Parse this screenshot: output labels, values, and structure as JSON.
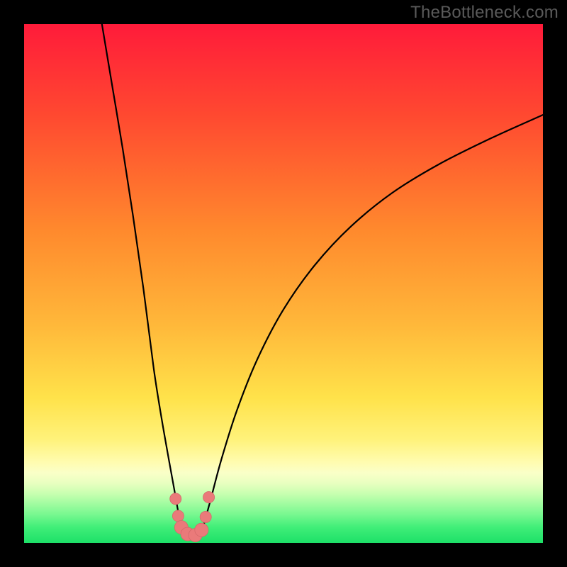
{
  "watermark": "TheBottleneck.com",
  "colors": {
    "bg_black": "#000000",
    "grad_top": "#ff1b3a",
    "grad_mid_upper": "#ff6a2a",
    "grad_mid": "#ffb03a",
    "grad_mid_lower": "#ffe24a",
    "grad_lightband1": "#fff6a8",
    "grad_lightband2": "#f8ffb0",
    "grad_green_light": "#8efc8f",
    "grad_green": "#29e36a",
    "curve_color": "#000000",
    "marker_fill": "#ea7a7a",
    "marker_stroke": "#d46a6a"
  },
  "chart_data": {
    "type": "line",
    "title": "",
    "xlabel": "",
    "ylabel": "",
    "xlim": [
      0,
      100
    ],
    "ylim": [
      0,
      100
    ],
    "note": "Values estimated from pixel positions; axes unlabeled so normalized 0-100 scale is used.",
    "series": [
      {
        "name": "left-branch",
        "x": [
          15.0,
          17.0,
          19.0,
          21.0,
          23.0,
          25.0,
          26.5,
          28.0,
          29.0,
          29.8,
          30.5
        ],
        "y": [
          100.0,
          88.0,
          76.0,
          63.0,
          49.0,
          33.5,
          24.0,
          15.5,
          10.0,
          5.5,
          2.5
        ]
      },
      {
        "name": "valley-floor",
        "x": [
          30.5,
          31.5,
          32.5,
          33.5,
          34.5
        ],
        "y": [
          2.5,
          1.5,
          1.3,
          1.6,
          3.0
        ]
      },
      {
        "name": "right-branch",
        "x": [
          34.5,
          36.0,
          38.0,
          41.0,
          45.0,
          50.0,
          56.0,
          63.0,
          71.0,
          80.0,
          90.0,
          100.0
        ],
        "y": [
          3.0,
          8.5,
          16.0,
          25.5,
          35.5,
          45.0,
          53.5,
          61.0,
          67.5,
          73.0,
          78.0,
          82.5
        ]
      }
    ],
    "markers": [
      {
        "x": 29.2,
        "y": 8.5,
        "r": 1.1
      },
      {
        "x": 29.7,
        "y": 5.2,
        "r": 1.1
      },
      {
        "x": 30.3,
        "y": 3.0,
        "r": 1.3
      },
      {
        "x": 31.5,
        "y": 1.7,
        "r": 1.3
      },
      {
        "x": 33.0,
        "y": 1.5,
        "r": 1.3
      },
      {
        "x": 34.2,
        "y": 2.5,
        "r": 1.3
      },
      {
        "x": 35.0,
        "y": 5.0,
        "r": 1.1
      },
      {
        "x": 35.6,
        "y": 8.8,
        "r": 1.1
      }
    ],
    "gradient_stops": [
      {
        "offset": 0.0,
        "color": "#ff1b3a"
      },
      {
        "offset": 0.18,
        "color": "#ff4a30"
      },
      {
        "offset": 0.4,
        "color": "#ff8a2d"
      },
      {
        "offset": 0.58,
        "color": "#ffb83a"
      },
      {
        "offset": 0.72,
        "color": "#ffe24a"
      },
      {
        "offset": 0.8,
        "color": "#fff27a"
      },
      {
        "offset": 0.845,
        "color": "#fffcb0"
      },
      {
        "offset": 0.865,
        "color": "#faffc8"
      },
      {
        "offset": 0.885,
        "color": "#e8ffc0"
      },
      {
        "offset": 0.905,
        "color": "#c8ffb0"
      },
      {
        "offset": 0.925,
        "color": "#a0fca0"
      },
      {
        "offset": 0.945,
        "color": "#78f890"
      },
      {
        "offset": 0.97,
        "color": "#40ee78"
      },
      {
        "offset": 1.0,
        "color": "#1de068"
      }
    ]
  }
}
